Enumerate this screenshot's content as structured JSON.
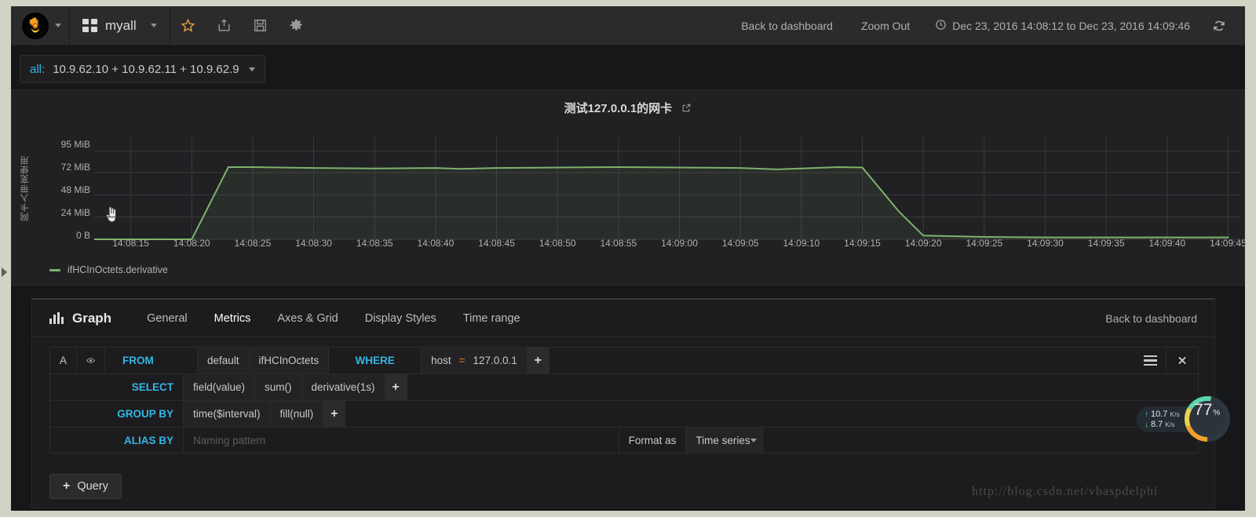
{
  "navbar": {
    "logo_icon": "grafana-logo-icon",
    "dashboard_name": "myall",
    "icons": [
      "star-icon",
      "share-icon",
      "save-icon",
      "gear-icon"
    ],
    "back_to_dashboard": "Back to dashboard",
    "zoom_out": "Zoom Out",
    "time_range": "Dec 23, 2016 14:08:12 to Dec 23, 2016 14:09:46",
    "refresh_icon": "refresh-icon",
    "clock_icon": "clock-icon"
  },
  "submenu": {
    "variable_label": "all:",
    "variable_value": "10.9.62.10 + 10.9.62.11 + 10.9.62.9"
  },
  "panel": {
    "title": "测试127.0.0.1的网卡",
    "external_link_icon": "external-link-icon",
    "legend": "ifHCInOctets.derivative",
    "legend_color": "#7eb26d"
  },
  "chart_data": {
    "type": "line",
    "title": "测试127.0.0.1的网卡",
    "xlabel": "",
    "ylabel": "网卡入带宽使用",
    "ytick_labels": [
      "95 MiB",
      "72 MiB",
      "48 MiB",
      "24 MiB",
      "0 B"
    ],
    "ytick_values": [
      95,
      72,
      48,
      24,
      0
    ],
    "ylim": [
      0,
      100
    ],
    "yunit": "MiB",
    "xtick_labels": [
      "14:08:15",
      "14:08:20",
      "14:08:25",
      "14:08:30",
      "14:08:35",
      "14:08:40",
      "14:08:45",
      "14:08:50",
      "14:08:55",
      "14:09:00",
      "14:09:05",
      "14:09:10",
      "14:09:15",
      "14:09:20",
      "14:09:25",
      "14:09:30",
      "14:09:35",
      "14:09:40",
      "14:09:45"
    ],
    "grid": true,
    "legend_position": "bottom-left",
    "series": [
      {
        "name": "ifHCInOctets.derivative",
        "color": "#7eb26d",
        "fill": true,
        "x": [
          "14:08:12",
          "14:08:15",
          "14:08:17",
          "14:08:20",
          "14:08:23",
          "14:08:25",
          "14:08:30",
          "14:08:35",
          "14:08:40",
          "14:08:42",
          "14:08:45",
          "14:08:50",
          "14:08:55",
          "14:09:00",
          "14:09:05",
          "14:09:08",
          "14:09:10",
          "14:09:13",
          "14:09:15",
          "14:09:18",
          "14:09:20",
          "14:09:25",
          "14:09:30",
          "14:09:35",
          "14:09:40",
          "14:09:45"
        ],
        "values": [
          0,
          0,
          0,
          0,
          78,
          78,
          77,
          76.5,
          77,
          76,
          77,
          77.5,
          78,
          77.5,
          77,
          75.5,
          76.5,
          78,
          77.5,
          30,
          4,
          2.5,
          2,
          2,
          2,
          2
        ]
      }
    ]
  },
  "editor": {
    "panel_type": "Graph",
    "panel_type_icon": "bar-chart-icon",
    "tabs": [
      {
        "label": "General",
        "active": false
      },
      {
        "label": "Metrics",
        "active": true
      },
      {
        "label": "Axes & Grid",
        "active": false
      },
      {
        "label": "Display Styles",
        "active": false
      },
      {
        "label": "Time range",
        "active": false
      }
    ],
    "back_to_dashboard": "Back to dashboard",
    "query": {
      "ref_id": "A",
      "eye_icon": "eye-icon",
      "from_label": "FROM",
      "from_policy": "default",
      "from_measurement": "ifHCInOctets",
      "where_label": "WHERE",
      "where_key": "host",
      "where_op": "=",
      "where_value": "127.0.0.1",
      "add_icon": "plus-icon",
      "menu_icon": "hamburger-icon",
      "close_icon": "close-icon",
      "select_label": "SELECT",
      "select_parts": [
        "field(value)",
        "sum()",
        "derivative(1s)"
      ],
      "groupby_label": "GROUP BY",
      "groupby_parts": [
        "time($interval)",
        "fill(null)"
      ],
      "alias_label": "ALIAS BY",
      "alias_placeholder": "Naming pattern",
      "format_as_label": "Format as",
      "format_as_value": "Time series"
    },
    "add_query_button": "Query",
    "add_query_icon": "plus-icon"
  },
  "speed_widget": {
    "upload": "10.7",
    "upload_unit": "K/s",
    "download": "8.7",
    "download_unit": "K/s",
    "gauge_value": "77",
    "gauge_unit": "%",
    "up_arrow": "↑",
    "down_arrow": "↓"
  },
  "watermark": "http://blog.csdn.net/vbaspdelphi"
}
